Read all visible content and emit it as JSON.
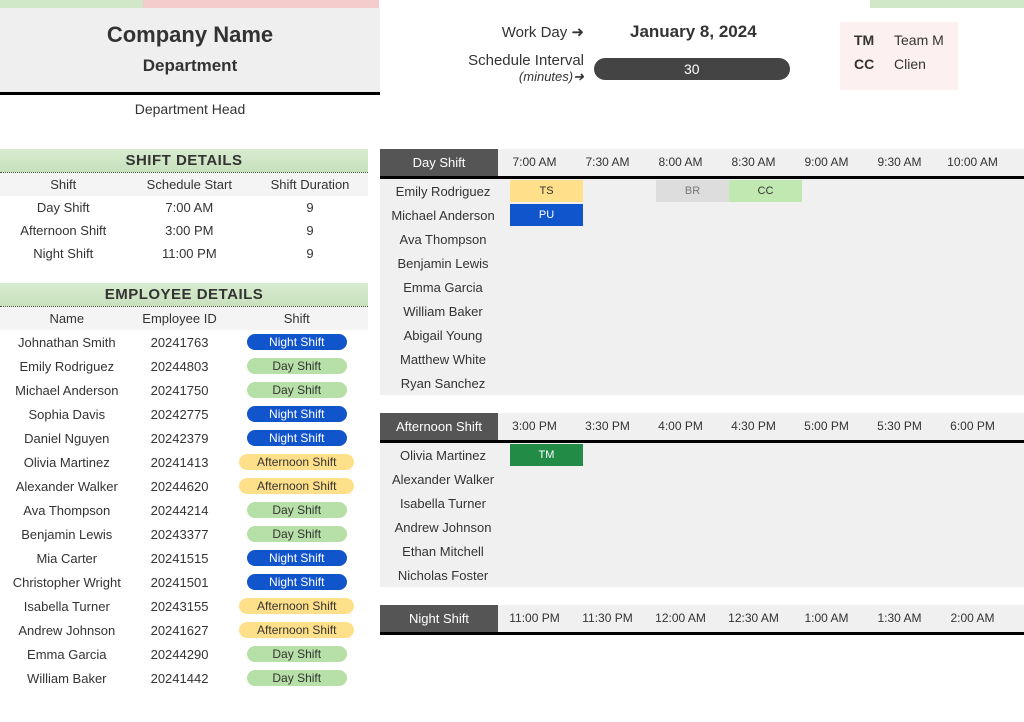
{
  "company": {
    "name": "Company Name",
    "department": "Department",
    "dept_head": "Department Head"
  },
  "header": {
    "workday_label": "Work Day ➜",
    "workday_value": "January 8, 2024",
    "interval_label": "Schedule Interval",
    "interval_sublabel": "(minutes)➜",
    "interval_value": "30"
  },
  "legend": [
    {
      "code": "TM",
      "desc": "Team M"
    },
    {
      "code": "CC",
      "desc": "Clien"
    }
  ],
  "shift_details": {
    "title": "SHIFT DETAILS",
    "headers": [
      "Shift",
      "Schedule Start",
      "Shift Duration"
    ],
    "rows": [
      {
        "shift": "Day Shift",
        "start": "7:00 AM",
        "dur": "9"
      },
      {
        "shift": "Afternoon Shift",
        "start": "3:00 PM",
        "dur": "9"
      },
      {
        "shift": "Night Shift",
        "start": "11:00 PM",
        "dur": "9"
      }
    ]
  },
  "employee_details": {
    "title": "EMPLOYEE DETAILS",
    "headers": [
      "Name",
      "Employee ID",
      "Shift"
    ],
    "rows": [
      {
        "name": "Johnathan Smith",
        "id": "20241763",
        "shift": "Night Shift",
        "cls": "night"
      },
      {
        "name": "Emily Rodriguez",
        "id": "20244803",
        "shift": "Day Shift",
        "cls": "day"
      },
      {
        "name": "Michael Anderson",
        "id": "20241750",
        "shift": "Day Shift",
        "cls": "day"
      },
      {
        "name": "Sophia Davis",
        "id": "20242775",
        "shift": "Night Shift",
        "cls": "night"
      },
      {
        "name": "Daniel Nguyen",
        "id": "20242379",
        "shift": "Night Shift",
        "cls": "night"
      },
      {
        "name": "Olivia Martinez",
        "id": "20241413",
        "shift": "Afternoon Shift",
        "cls": "afternoon"
      },
      {
        "name": "Alexander Walker",
        "id": "20244620",
        "shift": "Afternoon Shift",
        "cls": "afternoon"
      },
      {
        "name": "Ava Thompson",
        "id": "20244214",
        "shift": "Day Shift",
        "cls": "day"
      },
      {
        "name": "Benjamin Lewis",
        "id": "20243377",
        "shift": "Day Shift",
        "cls": "day"
      },
      {
        "name": "Mia Carter",
        "id": "20241515",
        "shift": "Night Shift",
        "cls": "night"
      },
      {
        "name": "Christopher Wright",
        "id": "20241501",
        "shift": "Night Shift",
        "cls": "night"
      },
      {
        "name": "Isabella Turner",
        "id": "20243155",
        "shift": "Afternoon Shift",
        "cls": "afternoon"
      },
      {
        "name": "Andrew Johnson",
        "id": "20241627",
        "shift": "Afternoon Shift",
        "cls": "afternoon"
      },
      {
        "name": "Emma Garcia",
        "id": "20244290",
        "shift": "Day Shift",
        "cls": "day"
      },
      {
        "name": "William Baker",
        "id": "20241442",
        "shift": "Day Shift",
        "cls": "day"
      }
    ]
  },
  "schedules": [
    {
      "shift": "Day Shift",
      "times": [
        "7:00 AM",
        "7:30 AM",
        "8:00 AM",
        "8:30 AM",
        "9:00 AM",
        "9:30 AM",
        "10:00 AM"
      ],
      "rows": [
        {
          "name": "Emily Rodriguez",
          "slots": [
            {
              "w": 1,
              "c": "ts",
              "t": "TS"
            },
            {
              "w": 1
            },
            {
              "w": 1,
              "c": "br",
              "t": "BR"
            },
            {
              "w": 1,
              "c": "cc",
              "t": "CC"
            }
          ]
        },
        {
          "name": "Michael Anderson",
          "slots": [
            {
              "w": 1,
              "c": "pu",
              "t": "PU"
            }
          ]
        },
        {
          "name": "Ava Thompson",
          "slots": []
        },
        {
          "name": "Benjamin Lewis",
          "slots": []
        },
        {
          "name": "Emma Garcia",
          "slots": []
        },
        {
          "name": "William Baker",
          "slots": []
        },
        {
          "name": "Abigail Young",
          "slots": []
        },
        {
          "name": "Matthew White",
          "slots": []
        },
        {
          "name": "Ryan Sanchez",
          "slots": []
        }
      ]
    },
    {
      "shift": "Afternoon Shift",
      "times": [
        "3:00 PM",
        "3:30 PM",
        "4:00 PM",
        "4:30 PM",
        "5:00 PM",
        "5:30 PM",
        "6:00 PM"
      ],
      "rows": [
        {
          "name": "Olivia Martinez",
          "slots": [
            {
              "w": 1,
              "c": "tm",
              "t": "TM"
            }
          ]
        },
        {
          "name": "Alexander Walker",
          "slots": []
        },
        {
          "name": "Isabella Turner",
          "slots": []
        },
        {
          "name": "Andrew Johnson",
          "slots": []
        },
        {
          "name": "Ethan Mitchell",
          "slots": []
        },
        {
          "name": "Nicholas Foster",
          "slots": []
        }
      ]
    },
    {
      "shift": "Night Shift",
      "times": [
        "11:00 PM",
        "11:30 PM",
        "12:00 AM",
        "12:30 AM",
        "1:00 AM",
        "1:30 AM",
        "2:00 AM"
      ],
      "rows": []
    }
  ]
}
